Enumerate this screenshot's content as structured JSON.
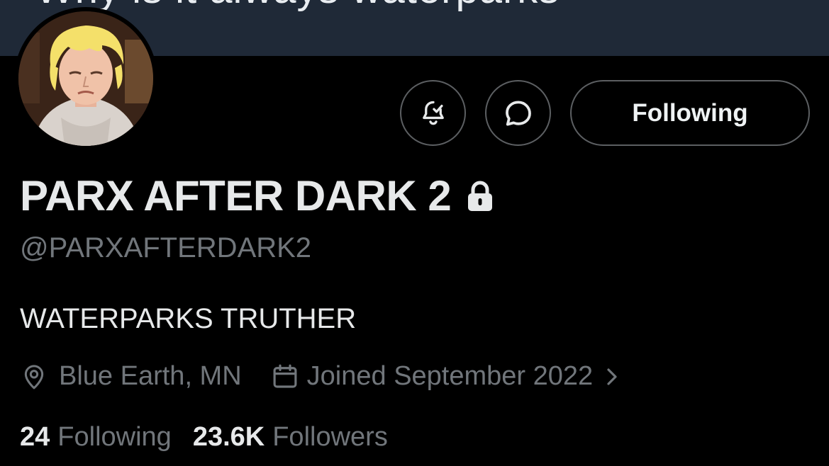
{
  "banner": {
    "partial_tweet_text": "Why is it always waterparks"
  },
  "profile": {
    "display_name": "PARX AFTER DARK 2",
    "handle": "@PARXAFTERDARK2",
    "bio": "WATERPARKS TRUTHER",
    "location": "Blue Earth, MN",
    "joined": "Joined September 2022",
    "protected_icon": "lock-icon",
    "following_count": "24",
    "following_label": "Following",
    "followers_count": "23.6K",
    "followers_label": "Followers"
  },
  "actions": {
    "notify_icon": "bell-check-icon",
    "message_icon": "message-bubble-icon",
    "follow_state_label": "Following"
  },
  "icons": {
    "location": "location-pin-icon",
    "calendar": "calendar-icon",
    "chevron": "chevron-right-icon"
  },
  "colors": {
    "background": "#000000",
    "banner": "#1f2937",
    "primary_text": "#e7e9ea",
    "secondary_text": "#71767b",
    "button_border": "#5c5f62"
  }
}
